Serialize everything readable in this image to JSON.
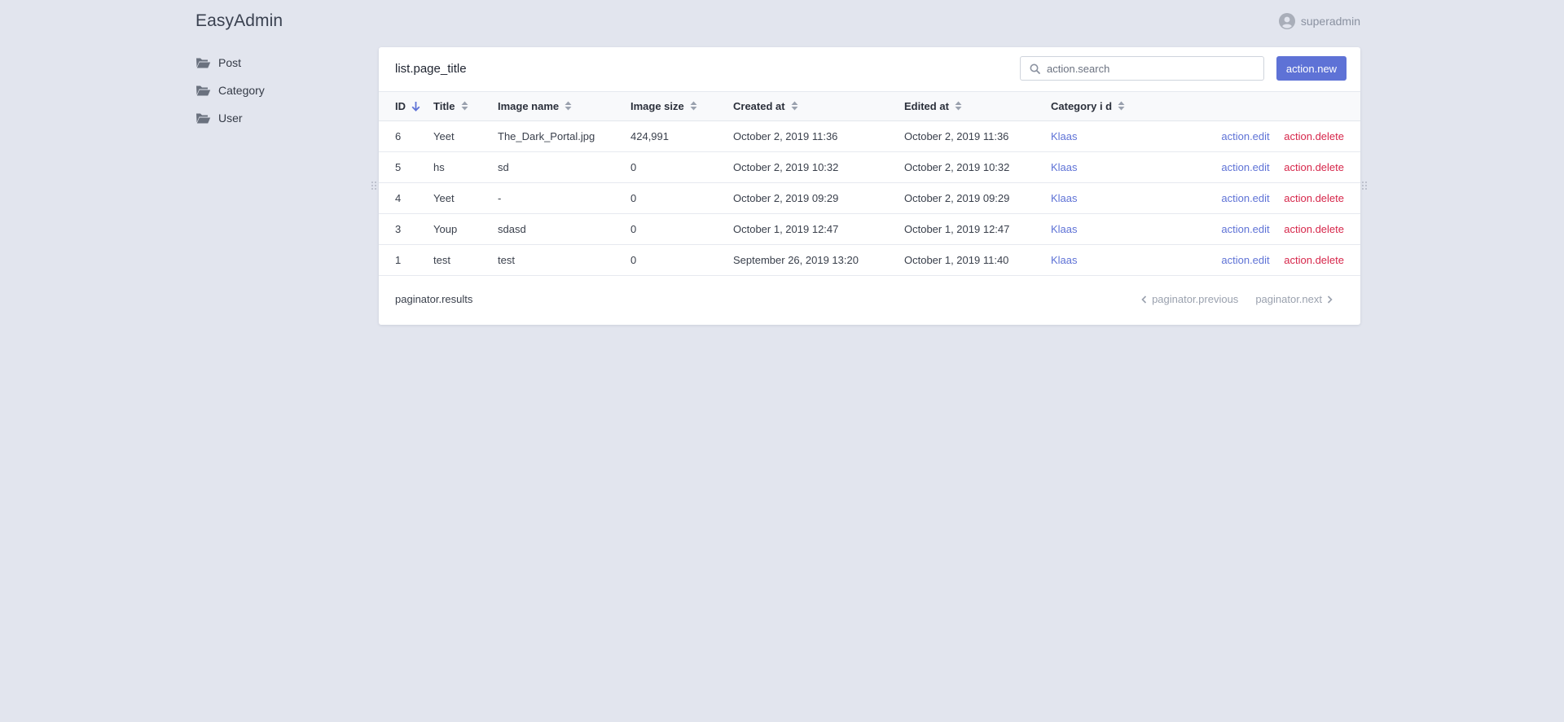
{
  "app": {
    "brand": "EasyAdmin"
  },
  "user": {
    "name": "superadmin"
  },
  "sidebar": {
    "items": [
      {
        "label": "Post"
      },
      {
        "label": "Category"
      },
      {
        "label": "User"
      }
    ]
  },
  "list": {
    "page_title": "list.page_title",
    "search_placeholder": "action.search",
    "new_label": "action.new",
    "columns": [
      "ID",
      "Title",
      "Image name",
      "Image size",
      "Created at",
      "Edited at",
      "Category i d"
    ],
    "rows": [
      {
        "id": "6",
        "title": "Yeet",
        "image_name": "The_Dark_Portal.jpg",
        "image_size": "424,991",
        "created_at": "October 2, 2019 11:36",
        "edited_at": "October 2, 2019 11:36",
        "category": "Klaas",
        "edit": "action.edit",
        "delete": "action.delete"
      },
      {
        "id": "5",
        "title": "hs",
        "image_name": "sd",
        "image_size": "0",
        "created_at": "October 2, 2019 10:32",
        "edited_at": "October 2, 2019 10:32",
        "category": "Klaas",
        "edit": "action.edit",
        "delete": "action.delete"
      },
      {
        "id": "4",
        "title": "Yeet",
        "image_name": "-",
        "image_size": "0",
        "created_at": "October 2, 2019 09:29",
        "edited_at": "October 2, 2019 09:29",
        "category": "Klaas",
        "edit": "action.edit",
        "delete": "action.delete"
      },
      {
        "id": "3",
        "title": "Youp",
        "image_name": "sdasd",
        "image_size": "0",
        "created_at": "October 1, 2019 12:47",
        "edited_at": "October 1, 2019 12:47",
        "category": "Klaas",
        "edit": "action.edit",
        "delete": "action.delete"
      },
      {
        "id": "1",
        "title": "test",
        "image_name": "test",
        "image_size": "0",
        "created_at": "September 26, 2019 13:20",
        "edited_at": "October 1, 2019 11:40",
        "category": "Klaas",
        "edit": "action.edit",
        "delete": "action.delete"
      }
    ]
  },
  "paginator": {
    "results": "paginator.results",
    "previous": "paginator.previous",
    "next": "paginator.next"
  },
  "colors": {
    "accent": "#5e72d6",
    "danger": "#d6264a",
    "background": "#e2e5ee"
  },
  "icons": {
    "folder": "folder-open-icon",
    "user": "user-circle-icon",
    "search": "search-icon",
    "sort_active": "arrow-down-icon",
    "sort": "sort-icon"
  }
}
